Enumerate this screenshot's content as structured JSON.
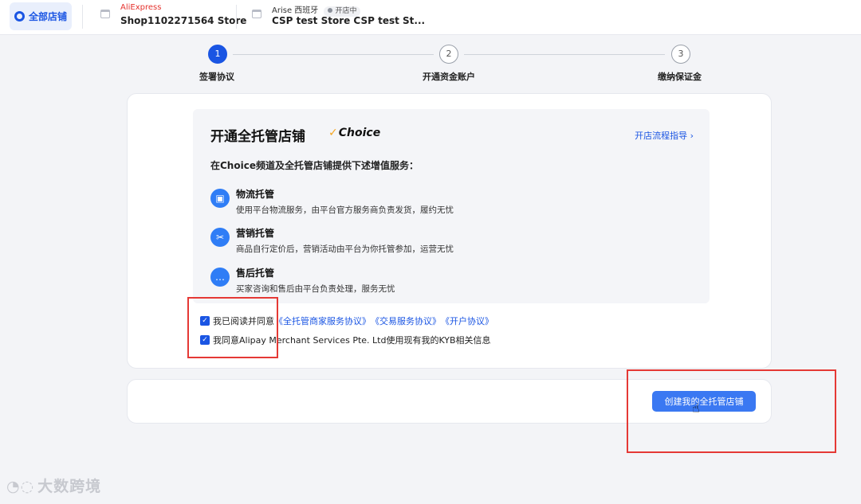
{
  "topbar": {
    "all_stores_label": "全部店铺",
    "stores": [
      {
        "platform": "AliExpress",
        "name": "Shop1102271564 Store",
        "status": ""
      },
      {
        "platform": "Arise 西班牙",
        "name": "CSP test Store CSP test St...",
        "status": "开店中"
      }
    ]
  },
  "stepper": {
    "steps": [
      {
        "number": "1",
        "label": "签署协议"
      },
      {
        "number": "2",
        "label": "开通资金账户"
      },
      {
        "number": "3",
        "label": "缴纳保证金"
      }
    ],
    "current_step": 1
  },
  "panel": {
    "title": "开通全托管店铺",
    "brand": "Choice",
    "guide_link": "开店流程指导 ›",
    "subtitle": "在Choice频道及全托管店铺提供下述增值服务：",
    "services": [
      {
        "icon": "package-icon",
        "title": "物流托管",
        "desc": "使用平台物流服务，由平台官方服务商负责发货，履约无忧"
      },
      {
        "icon": "ticket-icon",
        "title": "营销托管",
        "desc": "商品自行定价后，营销活动由平台为你托管参加，运营无忧"
      },
      {
        "icon": "chat-icon",
        "title": "售后托管",
        "desc": "买家咨询和售后由平台负责处理，服务无忧"
      }
    ]
  },
  "agreements": {
    "line1_prefix": "我已阅读并同意",
    "line1_links": [
      "《全托管商家服务协议》",
      "《交易服务协议》",
      "《开户协议》"
    ],
    "line2": "我同意Alipay Merchant Services Pte. Ltd使用现有我的KYB相关信息",
    "checked": [
      true,
      true
    ]
  },
  "actions": {
    "create_button": "创建我的全托管店铺"
  },
  "watermark": "大数跨境",
  "colors": {
    "primary": "#1a55e3",
    "button": "#3a78f2",
    "annotation": "#e53935",
    "aliexpress": "#e5322d"
  }
}
